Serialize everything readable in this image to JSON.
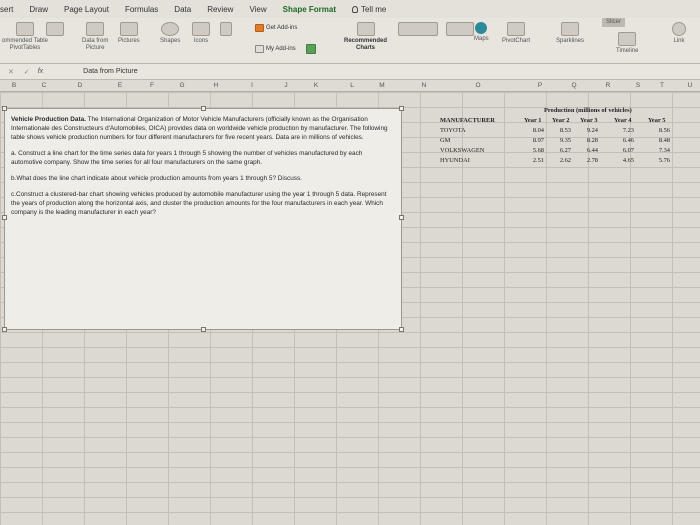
{
  "ribbon_tabs": [
    "sert",
    "Draw",
    "Page Layout",
    "Formulas",
    "Data",
    "Review",
    "View",
    "Shape Format",
    "Tell me"
  ],
  "ribbon": {
    "recommended_pivot": "ommended Table\nPivotTables",
    "table": "Table",
    "data_from_picture": "Data from\nPicture",
    "pictures": "Pictures",
    "shapes": "Shapes",
    "icons": "Icons",
    "get_addins": "Get Add-ins",
    "my_addins": "My Add-ins",
    "recommended_charts": "Recommended\nCharts",
    "maps": "Maps",
    "pivotchart": "PivotChart",
    "sparklines": "Sparklines",
    "slicer": "Slicer",
    "timeline": "Timeline",
    "link": "Link"
  },
  "formula_bar": {
    "cancel_confirm": "✕ ✓",
    "fx": "fx",
    "content": "Data from Picture"
  },
  "columns": [
    "B",
    "C",
    "D",
    "E",
    "F",
    "G",
    "H",
    "I",
    "J",
    "K",
    "L",
    "M",
    "N",
    "O",
    "P",
    "Q",
    "R",
    "S",
    "T",
    "U"
  ],
  "textbox": {
    "intro_bold": "Vehicle Production Data.",
    "intro": " The International Organization of Motor Vehicle Manufacturers (officially known as the Organisation Internationale des Constructeurs d'Automobiles, OICA) provides data on worldwide vehicle production by manufacturer. The following table shows vehicle production numbers for four different manufacturers for five recent years. Data are in millions of vehicles.",
    "part_a": "a. Construct a line chart for the time series data for years 1 through 5 showing the number of vehicles manufactured by each automotive company. Show the time series for all four manufacturers on the same graph.",
    "part_b": "b.What does the line chart indicate about vehicle production amounts from years 1 through 5? Discuss.",
    "part_c": "c.Construct a clustered-bar chart showing vehicles produced by automobile manufacturer using the year 1 through 5 data. Represent the years of production along the horizontal axis, and cluster the production amounts for the four manufacturers in each year. Which company is the leading manufacturer in each year?"
  },
  "table": {
    "title": "Production (millions of vehicles)",
    "header_manufacturer": "MANUFACTURER",
    "years": [
      "Year 1",
      "Year 2",
      "Year 3",
      "Year 4",
      "Year 5"
    ],
    "rows": [
      {
        "name": "TOYOTA",
        "values": [
          "8.04",
          "8.53",
          "9.24",
          "7.23",
          "8.56"
        ]
      },
      {
        "name": "GM",
        "values": [
          "8.97",
          "9.35",
          "8.28",
          "6.46",
          "8.48"
        ]
      },
      {
        "name": "VOLKSWAGEN",
        "values": [
          "5.68",
          "6.27",
          "6.44",
          "6.07",
          "7.34"
        ]
      },
      {
        "name": "HYUNDAI",
        "values": [
          "2.51",
          "2.62",
          "2.78",
          "4.65",
          "5.76"
        ]
      }
    ]
  }
}
